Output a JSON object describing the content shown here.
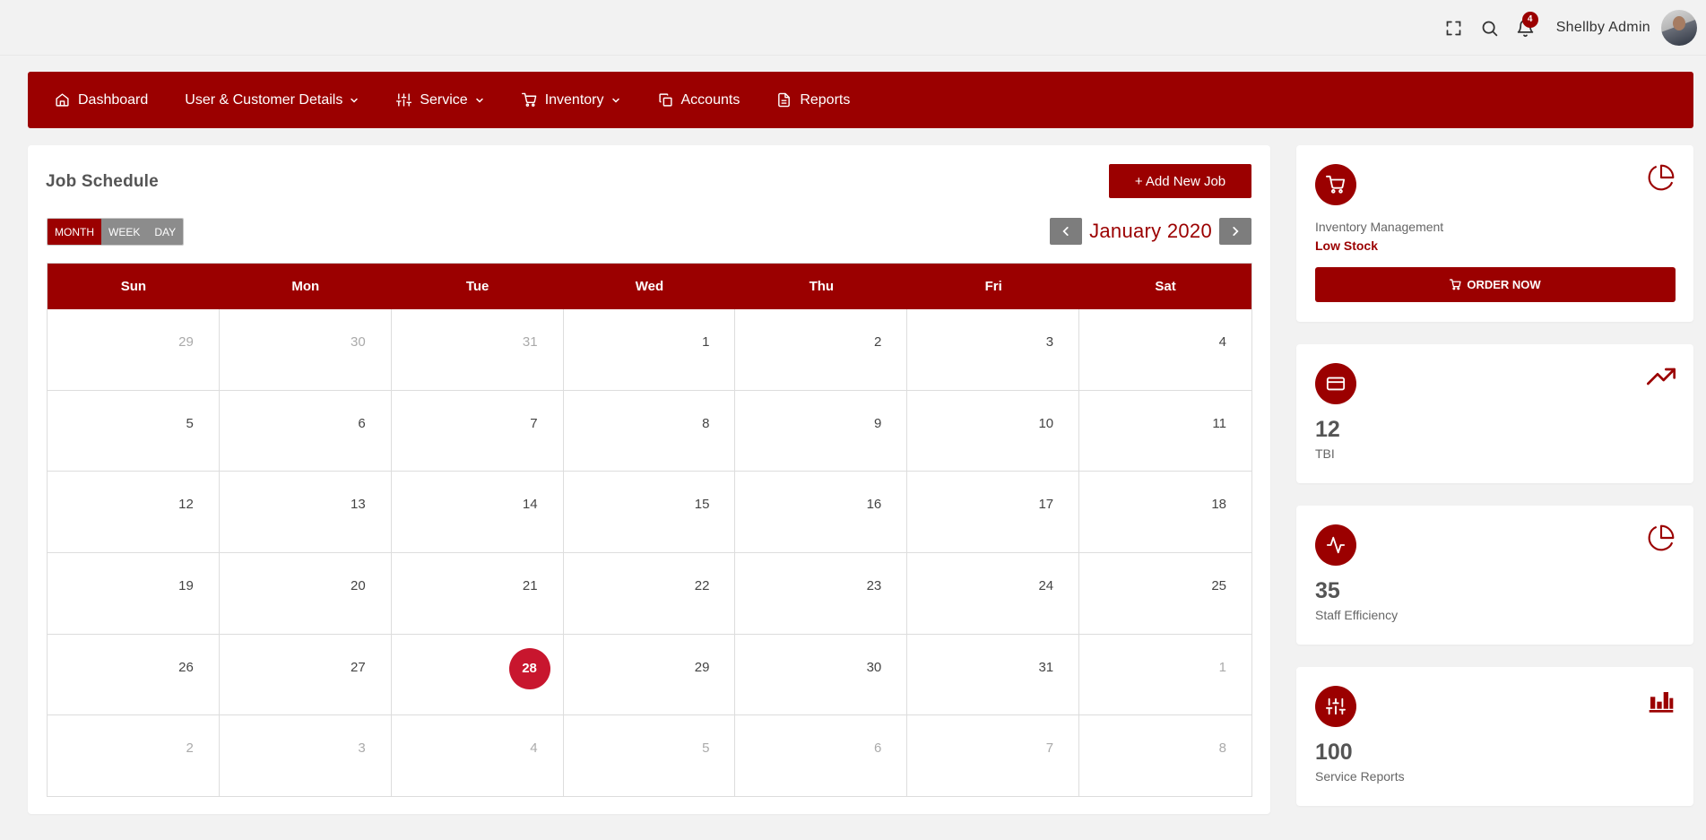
{
  "header": {
    "user_name": "Shellby Admin",
    "notification_count": "4",
    "icons": [
      "fullscreen-icon",
      "search-icon",
      "bell-icon"
    ]
  },
  "nav": {
    "items": [
      {
        "label": "Dashboard",
        "icon": "home-icon",
        "dropdown": false
      },
      {
        "label": "User & Customer Details",
        "icon": "",
        "dropdown": true
      },
      {
        "label": "Service",
        "icon": "sliders-icon",
        "dropdown": true
      },
      {
        "label": "Inventory",
        "icon": "cart-icon",
        "dropdown": true
      },
      {
        "label": "Accounts",
        "icon": "copy-icon",
        "dropdown": false
      },
      {
        "label": "Reports",
        "icon": "document-icon",
        "dropdown": false
      }
    ]
  },
  "schedule": {
    "title": "Job Schedule",
    "add_button": "+ Add New Job",
    "views": [
      "MONTH",
      "WEEK",
      "DAY"
    ],
    "active_view": "MONTH",
    "month_label": "January 2020",
    "weekdays": [
      "Sun",
      "Mon",
      "Tue",
      "Wed",
      "Thu",
      "Fri",
      "Sat"
    ],
    "days": [
      {
        "n": "29",
        "muted": true
      },
      {
        "n": "30",
        "muted": true
      },
      {
        "n": "31",
        "muted": true
      },
      {
        "n": "1"
      },
      {
        "n": "2"
      },
      {
        "n": "3"
      },
      {
        "n": "4"
      },
      {
        "n": "5"
      },
      {
        "n": "6"
      },
      {
        "n": "7"
      },
      {
        "n": "8"
      },
      {
        "n": "9"
      },
      {
        "n": "10"
      },
      {
        "n": "11"
      },
      {
        "n": "12"
      },
      {
        "n": "13"
      },
      {
        "n": "14"
      },
      {
        "n": "15"
      },
      {
        "n": "16"
      },
      {
        "n": "17"
      },
      {
        "n": "18"
      },
      {
        "n": "19"
      },
      {
        "n": "20"
      },
      {
        "n": "21"
      },
      {
        "n": "22"
      },
      {
        "n": "23"
      },
      {
        "n": "24"
      },
      {
        "n": "25"
      },
      {
        "n": "26"
      },
      {
        "n": "27"
      },
      {
        "n": "28",
        "today": true
      },
      {
        "n": "29"
      },
      {
        "n": "30"
      },
      {
        "n": "31"
      },
      {
        "n": "1",
        "muted": true
      },
      {
        "n": "2",
        "muted": true
      },
      {
        "n": "3",
        "muted": true
      },
      {
        "n": "4",
        "muted": true
      },
      {
        "n": "5",
        "muted": true
      },
      {
        "n": "6",
        "muted": true
      },
      {
        "n": "7",
        "muted": true
      },
      {
        "n": "8",
        "muted": true
      }
    ]
  },
  "side": {
    "inventory": {
      "label": "Inventory Management",
      "status": "Low Stock",
      "button": "ORDER NOW"
    },
    "tbi": {
      "value": "12",
      "label": "TBI"
    },
    "staff": {
      "value": "35",
      "label": "Staff Efficiency"
    },
    "service": {
      "value": "100",
      "label": "Service Reports"
    }
  },
  "colors": {
    "brand": "#9b0000",
    "today": "#c8162e",
    "muted_button": "#8c8c8c"
  }
}
